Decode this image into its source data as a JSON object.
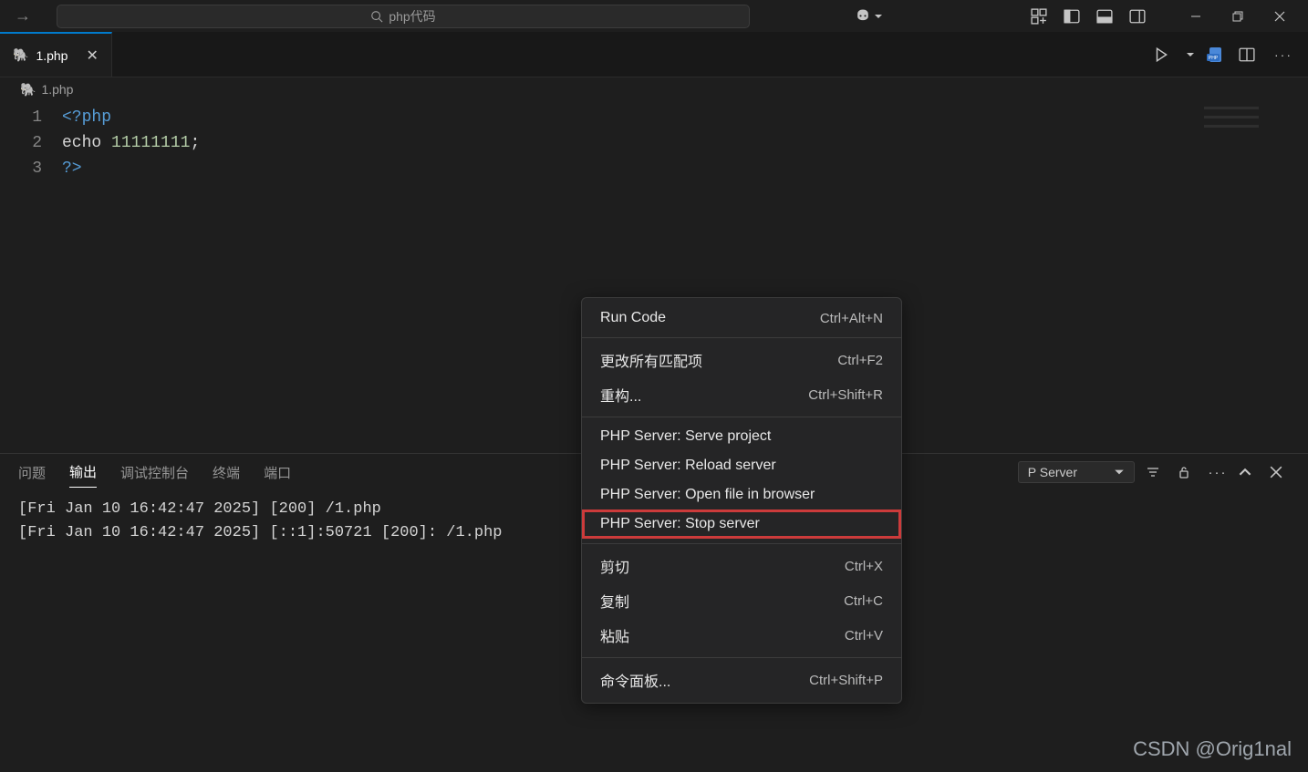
{
  "titlebar": {
    "search_text": "php代码"
  },
  "tab": {
    "filename": "1.php",
    "breadcrumb": "1.php"
  },
  "editor": {
    "lines": [
      {
        "num": "1",
        "html": "php_open"
      },
      {
        "num": "2",
        "html": "echo_line"
      },
      {
        "num": "3",
        "html": "php_close"
      }
    ],
    "tokens": {
      "php_open": "<?php",
      "echo": "echo",
      "number": "11111111",
      "semi": ";",
      "php_close": "?>"
    }
  },
  "panel": {
    "tabs": {
      "problems": "问题",
      "output": "输出",
      "debug_console": "调试控制台",
      "terminal": "终端",
      "ports": "端口"
    },
    "dropdown_label": "P Server",
    "logs": [
      "[Fri Jan 10 16:42:47 2025] [200] /1.php",
      "[Fri Jan 10 16:42:47 2025] [::1]:50721 [200]: /1.php"
    ]
  },
  "context_menu": {
    "items": [
      {
        "label": "Run Code",
        "shortcut": "Ctrl+Alt+N",
        "sep_after": true
      },
      {
        "label": "更改所有匹配项",
        "shortcut": "Ctrl+F2"
      },
      {
        "label": "重构...",
        "shortcut": "Ctrl+Shift+R",
        "sep_after": true
      },
      {
        "label": "PHP Server: Serve project",
        "shortcut": ""
      },
      {
        "label": "PHP Server: Reload server",
        "shortcut": ""
      },
      {
        "label": "PHP Server: Open file in browser",
        "shortcut": ""
      },
      {
        "label": "PHP Server: Stop server",
        "shortcut": "",
        "highlight": true,
        "sep_after": true
      },
      {
        "label": "剪切",
        "shortcut": "Ctrl+X"
      },
      {
        "label": "复制",
        "shortcut": "Ctrl+C"
      },
      {
        "label": "粘贴",
        "shortcut": "Ctrl+V",
        "sep_after": true
      },
      {
        "label": "命令面板...",
        "shortcut": "Ctrl+Shift+P"
      }
    ]
  },
  "watermark": "CSDN @Orig1nal"
}
